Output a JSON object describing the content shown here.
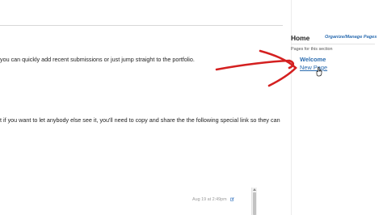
{
  "content": {
    "paragraph_1": "you can quickly add recent submissions or just jump straight to the portfolio.",
    "paragraph_2": "t if you want to let anybody else see it, you'll need to copy and share the the following special link so they can",
    "entry_meta": "Aug 19 at 2:49pm"
  },
  "sidebar": {
    "home_title": "Home",
    "organize_link": "Organize/Manage Pages",
    "section_label": "Pages for this section",
    "pages": [
      {
        "label": "Welcome"
      },
      {
        "label": "New Page"
      }
    ]
  },
  "icons": {
    "edit": "pencil-edit-icon",
    "cursor": "hand-pointer-cursor"
  },
  "colors": {
    "link": "#2b6cb0",
    "annotation": "#d42020"
  }
}
